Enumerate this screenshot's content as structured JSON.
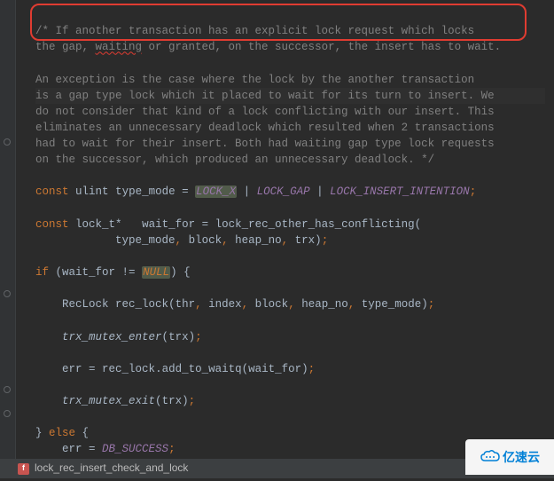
{
  "comment_block1_l1": "/* If another transaction has an explicit lock request which locks",
  "comment_block1_l2a": "the gap, ",
  "comment_block1_l2_wave": "waiting",
  "comment_block1_l2b": " or granted, on the successor, the insert has to wait.",
  "comment_block2_l1": "An exception is the case where the lock by the another transaction",
  "comment_block2_l2": "is a gap type lock which it placed to wait for its turn to insert. We",
  "comment_block2_l3": "do not consider that kind of a lock conflicting with our insert. This",
  "comment_block2_l4": "eliminates an unnecessary deadlock which resulted when 2 transactions",
  "comment_block2_l5": "had to wait for their insert. Both had waiting gap type lock requests",
  "comment_block2_l6": "on the successor, which produced an unnecessary deadlock. */",
  "kw_const": "const",
  "type_ulint": "ulint",
  "var_type_mode": "type_mode",
  "eq": " = ",
  "const_lock_x": "LOCK_X",
  "pipe": " | ",
  "const_lock_gap": "LOCK_GAP",
  "const_lock_ins": "LOCK_INSERT_INTENTION",
  "semicolon": ";",
  "type_lock_t": "lock_t",
  "star": "*",
  "var_wait_for": "wait_for",
  "fn_conflicting": "lock_rec_other_has_conflicting",
  "args_conflicting": "type_mode",
  "arg_block": "block",
  "arg_heap_no": "heap_no",
  "arg_trx": "trx",
  "kw_if": "if",
  "neq": " != ",
  "null_kw": "NULL",
  "brace_open": " {",
  "brace_close": "}",
  "type_reclock": "RecLock",
  "var_rec_lock": "rec_lock",
  "args_reclock_a": "thr",
  "args_reclock_b": "index",
  "fn_trx_enter": "trx_mutex_enter",
  "fn_trx_exit": "trx_mutex_exit",
  "var_err": "err",
  "method_add": "add_to_waitq",
  "kw_else": "else",
  "const_db_success": "DB_SUCCESS",
  "watermark_text": "亿速云",
  "breadcrumb_fn": "lock_rec_insert_check_and_lock",
  "bc_icon_letter": "f",
  "chart_data": null
}
